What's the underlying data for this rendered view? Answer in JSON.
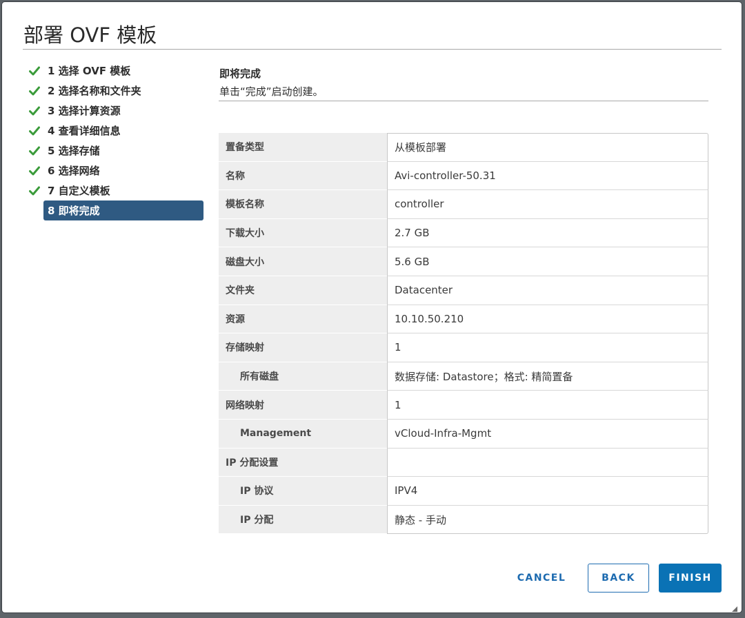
{
  "dialog": {
    "title": "部署 OVF 模板"
  },
  "steps": [
    {
      "label": "1 选择 OVF 模板",
      "done": true
    },
    {
      "label": "2 选择名称和文件夹",
      "done": true
    },
    {
      "label": "3 选择计算资源",
      "done": true
    },
    {
      "label": "4 查看详细信息",
      "done": true
    },
    {
      "label": "5 选择存储",
      "done": true
    },
    {
      "label": "6 选择网络",
      "done": true
    },
    {
      "label": "7 自定义模板",
      "done": true
    },
    {
      "label": "8 即将完成",
      "done": false,
      "active": true
    }
  ],
  "main": {
    "title": "即将完成",
    "description": "单击“完成”启动创建。",
    "rows": [
      {
        "key": "置备类型",
        "value": "从模板部署"
      },
      {
        "key": "名称",
        "value": "Avi-controller-50.31"
      },
      {
        "key": "模板名称",
        "value": "controller"
      },
      {
        "key": "下载大小",
        "value": "2.7 GB"
      },
      {
        "key": "磁盘大小",
        "value": "5.6 GB"
      },
      {
        "key": "文件夹",
        "value": "Datacenter"
      },
      {
        "key": "资源",
        "value": "10.10.50.210"
      },
      {
        "key": "存储映射",
        "value": "1"
      },
      {
        "key": "所有磁盘",
        "value": "数据存储: Datastore；格式: 精简置备",
        "indent": true
      },
      {
        "key": "网络映射",
        "value": "1"
      },
      {
        "key": "Management",
        "value": "vCloud-Infra-Mgmt",
        "indent": true
      },
      {
        "key": "IP 分配设置",
        "value": ""
      },
      {
        "key": "IP 协议",
        "value": "IPV4",
        "indent": true
      },
      {
        "key": "IP 分配",
        "value": "静态 - 手动",
        "indent": true
      }
    ]
  },
  "buttons": {
    "cancel": "CANCEL",
    "back": "BACK",
    "finish": "FINISH"
  },
  "colors": {
    "check": "#3a9b3a",
    "active_step_bg": "#2f5a82",
    "primary": "#0a72b5"
  },
  "icons": {
    "step_done": "check-icon",
    "resize": "resize-grip-icon"
  }
}
